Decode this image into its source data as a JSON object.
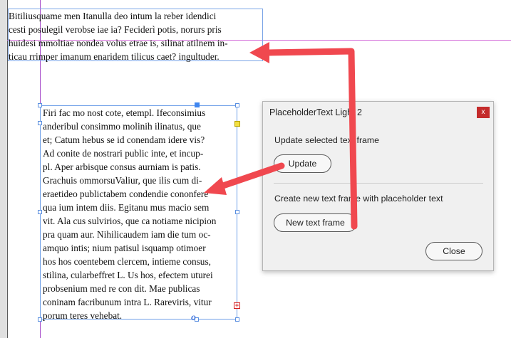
{
  "document": {
    "frame1_lines": [
      "Bitiliusquame men Itanulla deo intum la reber idendici",
      "cesti posulegil verobse iae ia? Feciderì potis, norurs pris",
      "huidesi mmoltiae nondea volus etrae is, silinat atilnem in-",
      "ticau rrimper imanum enaridem tilicus caet? ingultuder."
    ],
    "frame2_lines": [
      "Firi fac mo nost cote, etempl. Ifeconsimius",
      "anderibul consimmo molinih ilinatus, que",
      "et; Catum hebus se id conendam idere vis?",
      "Ad conite de nostrari public inte, et incup-",
      "pl. Aper arbisque consus aurniam is patis.",
      "Grachuis ommorsuValiur, que ilis cum di-",
      "eraetideo publictabem condendie cononfere",
      "qua ium intem diis. Egitanu mus macio sem",
      "vit. Ala cus sulvirios, que ca notiame nicipion",
      "pra quam aur. Nihilicaudem iam die tum oc-",
      "amquo intis; nium patisul isquamp otimoer",
      "hos hos coentebem clercem, intieme consus,",
      "stilina, cularbeffret L. Us hos, efectem uturei",
      "probsenium med re con dit. Mae publicas",
      "coninam facribunum intra L. Rareviris, vitur",
      "porum teres vehebat."
    ],
    "anchor_glyph": "o",
    "overset_glyph": "+"
  },
  "dialog": {
    "title": "PlaceholderText Light 2",
    "close_glyph": "x",
    "update_section_label": "Update selected text frame",
    "update_button": "Update",
    "new_section_label": "Create new text frame with placeholder text",
    "new_button": "New text frame",
    "close_button": "Close"
  },
  "colors": {
    "arrow": "#f0484f",
    "frame_border": "#6e9fe8",
    "guide_vertical": "#a64ac9",
    "guide_horizontal": "#d36ad8",
    "close_red": "#c42b2b"
  }
}
